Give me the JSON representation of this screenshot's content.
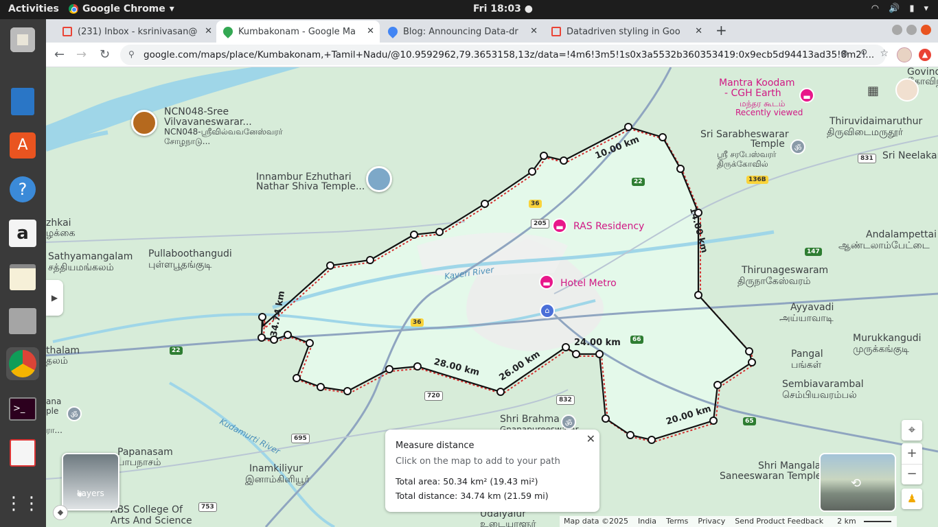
{
  "topbar": {
    "activities": "Activities",
    "app_name": "Google Chrome",
    "clock": "Fri 18:03"
  },
  "browser": {
    "tabs": [
      {
        "label": "(231) Inbox - ksrinivasan@"
      },
      {
        "label": "Kumbakonam - Google Ma"
      },
      {
        "label": "Blog: Announcing Data-dr"
      },
      {
        "label": "Datadriven styling in Goo"
      }
    ],
    "url": "google.com/maps/place/Kumbakonam,+Tamil+Nadu/@10.9592962,79.3653158,13z/data=!4m6!3m5!1s0x3a5532b360353419:0x9ecb5d94413ad35!8m2!..."
  },
  "map": {
    "labels": [
      {
        "id": "ncn048",
        "text": "NCN048-Sree"
      },
      {
        "id": "ncn048b",
        "text": "Vilvavaneswarar..."
      },
      {
        "id": "ncn048c",
        "text": "NCN048-ஸ்ரீவில்வவனேஸ்வரர்"
      },
      {
        "id": "ncn048d",
        "text": "சோழநாடு..."
      },
      {
        "id": "innambur",
        "text": "Innambur Ezhuthari"
      },
      {
        "id": "innambur2",
        "text": "Nathar Shiva Temple..."
      },
      {
        "id": "zhkai",
        "text": "zhkai"
      },
      {
        "id": "zhkai_ta",
        "text": "ழக்கை"
      },
      {
        "id": "sathya",
        "text": "Sathyamangalam"
      },
      {
        "id": "sathya_ta",
        "text": "சத்தியமங்கலம்"
      },
      {
        "id": "pulla",
        "text": "Pullaboothangudi"
      },
      {
        "id": "pulla_ta",
        "text": "புள்ளபூதங்குடி"
      },
      {
        "id": "thalam",
        "text": "thalam"
      },
      {
        "id": "thalam_ta",
        "text": "தலம்"
      },
      {
        "id": "papanasam",
        "text": "Papanasam"
      },
      {
        "id": "papanasam_ta",
        "text": "பாபநாசம்"
      },
      {
        "id": "inam",
        "text": "Inamkiliyur"
      },
      {
        "id": "inam_ta",
        "text": "இனாம்கிளியூர்"
      },
      {
        "id": "abs",
        "text": "ABS College Of"
      },
      {
        "id": "abs2",
        "text": "Arts And Science"
      },
      {
        "id": "udaiyalur",
        "text": "Udaiyalur"
      },
      {
        "id": "udaiyalur_ta",
        "text": "உடையாளூர்"
      },
      {
        "id": "brahma",
        "text": "Shri Brahma"
      },
      {
        "id": "brahma2",
        "text": "Gnanapureeswarar"
      },
      {
        "id": "kaveri",
        "text": "Kaveri River"
      },
      {
        "id": "kudamurti",
        "text": "Kudamurti River"
      },
      {
        "id": "sarabhe",
        "text": "Sri Sarabheswarar"
      },
      {
        "id": "sarabhe2",
        "text": "Temple"
      },
      {
        "id": "sarabhe_ta",
        "text": "ஸ்ரீ சரபேஸ்வரர்"
      },
      {
        "id": "sarabhe_ta2",
        "text": "திருக்கோவில்"
      },
      {
        "id": "thiruvidai",
        "text": "Thiruvidaimaruthur"
      },
      {
        "id": "thiruvidai_ta",
        "text": "திருவிடைமருதூர்"
      },
      {
        "id": "neelakan",
        "text": "Sri Neelakan"
      },
      {
        "id": "govind",
        "text": "Govind"
      },
      {
        "id": "govind_ta",
        "text": "கோவிந்"
      },
      {
        "id": "andal",
        "text": "Andalampettai"
      },
      {
        "id": "andal_ta",
        "text": "ஆண்டலாம்பேட்டை"
      },
      {
        "id": "thiruna",
        "text": "Thirunageswaram"
      },
      {
        "id": "thiruna_ta",
        "text": "திருநாகேஸ்வரம்"
      },
      {
        "id": "ayya",
        "text": "Ayyavadi"
      },
      {
        "id": "ayya_ta",
        "text": "அய்யாவாடி"
      },
      {
        "id": "murukk",
        "text": "Murukkangudi"
      },
      {
        "id": "murukk_ta",
        "text": "முருக்கங்குடி"
      },
      {
        "id": "pangal",
        "text": "Pangal"
      },
      {
        "id": "pangal_ta",
        "text": "பங்கள்"
      },
      {
        "id": "sembia",
        "text": "Sembiavarambal"
      },
      {
        "id": "sembia_ta",
        "text": "செம்பியவரம்பல்"
      },
      {
        "id": "mangala",
        "text": "Shri Mangala"
      },
      {
        "id": "mangala2",
        "text": "Saneeswaran Temple"
      },
      {
        "id": "ana",
        "text": "ana"
      },
      {
        "id": "ple",
        "text": "ple"
      },
      {
        "id": "ra",
        "text": "ரா..."
      }
    ],
    "pois": {
      "mantra": "Mantra Koodam",
      "mantra2": "- CGH Earth",
      "mantra_ta": "மந்தர கூடம்",
      "mantra_recent": "Recently viewed",
      "ras": "RAS Residency",
      "metro": "Hotel Metro"
    },
    "shields": [
      {
        "id": "s36a",
        "text": "36"
      },
      {
        "id": "s36b",
        "text": "36"
      },
      {
        "id": "s22a",
        "text": "22"
      },
      {
        "id": "s22b",
        "text": "22"
      },
      {
        "id": "s205",
        "text": "205"
      },
      {
        "id": "s136b",
        "text": "136B"
      },
      {
        "id": "s831",
        "text": "831"
      },
      {
        "id": "s147",
        "text": "147"
      },
      {
        "id": "s66",
        "text": "66"
      },
      {
        "id": "s65",
        "text": "65"
      },
      {
        "id": "s720",
        "text": "720"
      },
      {
        "id": "s832",
        "text": "832"
      },
      {
        "id": "s695",
        "text": "695"
      },
      {
        "id": "s753",
        "text": "753"
      }
    ],
    "distances": [
      "10.00 km",
      "14.00 km",
      "34.74 km",
      "24.00 km",
      "26.00 km",
      "28.00 km",
      "20.00 km"
    ],
    "layers_label": "Layers"
  },
  "measure": {
    "title": "Measure distance",
    "subtitle": "Click on the map to add to your path",
    "total_area": "Total area: 50.34 km² (19.43 mi²)",
    "total_distance": "Total distance: 34.74 km (21.59 mi)"
  },
  "footer": {
    "map_data": "Map data ©2025",
    "country": "India",
    "terms": "Terms",
    "privacy": "Privacy",
    "feedback": "Send Product Feedback",
    "scale": "2 km"
  },
  "colors": {
    "polygon_fill": "#e6fbec",
    "path": "#111111",
    "boundary": "#d32f2f",
    "poi": "#d01884"
  }
}
